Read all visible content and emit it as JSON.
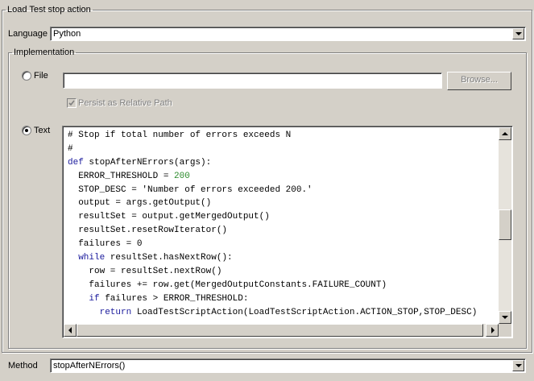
{
  "group_title": "Load Test stop action",
  "language": {
    "label": "Language",
    "value": "Python"
  },
  "implementation": {
    "title": "Implementation",
    "file_radio": {
      "label": "File",
      "selected": false
    },
    "file_path": "",
    "browse_label": "Browse...",
    "persist_label": "Persist as Relative Path",
    "persist_checked": true,
    "text_radio": {
      "label": "Text",
      "selected": true
    }
  },
  "code": {
    "lines": [
      "# Stop if total number of errors exceeds N",
      "#",
      "def stopAfterNErrors(args):",
      "  ERROR_THRESHOLD = 200",
      "  STOP_DESC = 'Number of errors exceeded 200.'",
      "  output = args.getOutput()",
      "  resultSet = output.getMergedOutput()",
      "  resultSet.resetRowIterator()",
      "  failures = 0",
      "  while resultSet.hasNextRow():",
      "    row = resultSet.nextRow()",
      "    failures += row.get(MergedOutputConstants.FAILURE_COUNT)",
      "    if failures > ERROR_THRESHOLD:",
      "      return LoadTestScriptAction(LoadTestScriptAction.ACTION_STOP,STOP_DESC)"
    ],
    "keywords": [
      "def",
      "while",
      "if",
      "return"
    ],
    "keyword_color": "#1a1a9c",
    "number_color": "#2a8a2a",
    "vertical_scroll_position": 0.55,
    "horizontal_scroll_position": 0
  },
  "method": {
    "label": "Method",
    "value": "stopAfterNErrors()"
  },
  "icons": {
    "combo_arrow": "chevron-down-icon",
    "scroll_up": "scroll-up-arrow-icon",
    "scroll_down": "scroll-down-arrow-icon",
    "scroll_left": "scroll-left-arrow-icon",
    "scroll_right": "scroll-right-arrow-icon",
    "check": "check-icon"
  }
}
